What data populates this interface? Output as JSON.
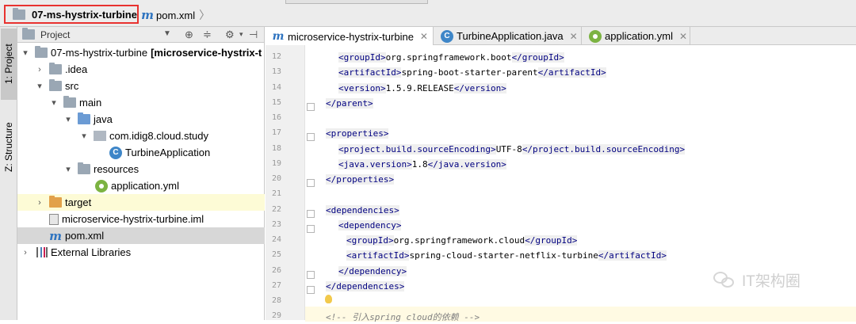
{
  "breadcrumb": {
    "project": "07-ms-hystrix-turbine",
    "file": "pom.xml"
  },
  "toolstrip": {
    "project_tab": "1: Project",
    "structure_tab": "Z: Structure"
  },
  "project_panel": {
    "title": "Project",
    "tree": [
      {
        "label": "07-ms-hystrix-turbine",
        "module": "[microservice-hystrix-t"
      },
      {
        "label": ".idea"
      },
      {
        "label": "src"
      },
      {
        "label": "main"
      },
      {
        "label": "java"
      },
      {
        "label": "com.idig8.cloud.study"
      },
      {
        "label": "TurbineApplication"
      },
      {
        "label": "resources"
      },
      {
        "label": "application.yml"
      },
      {
        "label": "target"
      },
      {
        "label": "microservice-hystrix-turbine.iml"
      },
      {
        "label": "pom.xml"
      },
      {
        "label": "External Libraries"
      }
    ]
  },
  "editor_tabs": [
    {
      "label": "microservice-hystrix-turbine",
      "icon": "maven-icon",
      "active": true
    },
    {
      "label": "TurbineApplication.java",
      "icon": "spring-class-icon",
      "active": false
    },
    {
      "label": "application.yml",
      "icon": "spring-yml-icon",
      "active": false
    }
  ],
  "code_lines": [
    {
      "n": "12",
      "tag1": "<groupId>",
      "text": "org.springframework.boot",
      "tag2": "</groupId>"
    },
    {
      "n": "13",
      "tag1": "<artifactId>",
      "text": "spring-boot-starter-parent",
      "tag2": "</artifactId>"
    },
    {
      "n": "14",
      "tag1": "<version>",
      "text": "1.5.9.RELEASE",
      "tag2": "</version>"
    },
    {
      "n": "15",
      "tag1": "</parent>",
      "text": "",
      "tag2": ""
    },
    {
      "n": "16",
      "tag1": "",
      "text": "",
      "tag2": ""
    },
    {
      "n": "17",
      "tag1": "<properties>",
      "text": "",
      "tag2": ""
    },
    {
      "n": "18",
      "tag1": "<project.build.sourceEncoding>",
      "text": "UTF-8",
      "tag2": "</project.build.sourceEncoding>"
    },
    {
      "n": "19",
      "tag1": "<java.version>",
      "text": "1.8",
      "tag2": "</java.version>"
    },
    {
      "n": "20",
      "tag1": "</properties>",
      "text": "",
      "tag2": ""
    },
    {
      "n": "21",
      "tag1": "",
      "text": "",
      "tag2": ""
    },
    {
      "n": "22",
      "tag1": "<dependencies>",
      "text": "",
      "tag2": ""
    },
    {
      "n": "23",
      "tag1": "<dependency>",
      "text": "",
      "tag2": ""
    },
    {
      "n": "24",
      "tag1": "<groupId>",
      "text": "org.springframework.cloud",
      "tag2": "</groupId>"
    },
    {
      "n": "25",
      "tag1": "<artifactId>",
      "text": "spring-cloud-starter-netflix-turbine",
      "tag2": "</artifactId>"
    },
    {
      "n": "26",
      "tag1": "</dependency>",
      "text": "",
      "tag2": ""
    },
    {
      "n": "27",
      "tag1": "</dependencies>",
      "text": "",
      "tag2": ""
    },
    {
      "n": "28",
      "tag1": "",
      "text": "",
      "tag2": ""
    },
    {
      "n": "29",
      "comment": "<!-- 引入spring cloud的依赖 -->"
    }
  ],
  "watermark": "IT架构圈",
  "colors": {
    "highlight_border": "#e8322f",
    "xml_tag": "#000080",
    "selected_row": "#d7d7d7",
    "excluded_row": "#fdfbd6"
  }
}
